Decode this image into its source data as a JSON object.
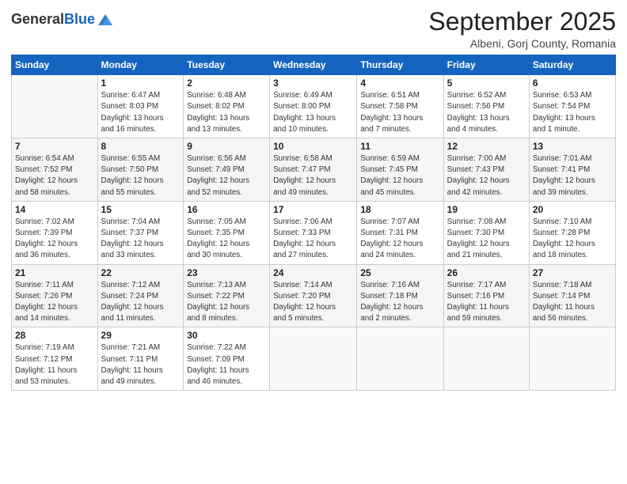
{
  "logo": {
    "general": "General",
    "blue": "Blue"
  },
  "header": {
    "title": "September 2025",
    "subtitle": "Albeni, Gorj County, Romania"
  },
  "days_of_week": [
    "Sunday",
    "Monday",
    "Tuesday",
    "Wednesday",
    "Thursday",
    "Friday",
    "Saturday"
  ],
  "weeks": [
    [
      {
        "num": "",
        "info": ""
      },
      {
        "num": "1",
        "info": "Sunrise: 6:47 AM\nSunset: 8:03 PM\nDaylight: 13 hours\nand 16 minutes."
      },
      {
        "num": "2",
        "info": "Sunrise: 6:48 AM\nSunset: 8:02 PM\nDaylight: 13 hours\nand 13 minutes."
      },
      {
        "num": "3",
        "info": "Sunrise: 6:49 AM\nSunset: 8:00 PM\nDaylight: 13 hours\nand 10 minutes."
      },
      {
        "num": "4",
        "info": "Sunrise: 6:51 AM\nSunset: 7:58 PM\nDaylight: 13 hours\nand 7 minutes."
      },
      {
        "num": "5",
        "info": "Sunrise: 6:52 AM\nSunset: 7:56 PM\nDaylight: 13 hours\nand 4 minutes."
      },
      {
        "num": "6",
        "info": "Sunrise: 6:53 AM\nSunset: 7:54 PM\nDaylight: 13 hours\nand 1 minute."
      }
    ],
    [
      {
        "num": "7",
        "info": "Sunrise: 6:54 AM\nSunset: 7:52 PM\nDaylight: 12 hours\nand 58 minutes."
      },
      {
        "num": "8",
        "info": "Sunrise: 6:55 AM\nSunset: 7:50 PM\nDaylight: 12 hours\nand 55 minutes."
      },
      {
        "num": "9",
        "info": "Sunrise: 6:56 AM\nSunset: 7:49 PM\nDaylight: 12 hours\nand 52 minutes."
      },
      {
        "num": "10",
        "info": "Sunrise: 6:58 AM\nSunset: 7:47 PM\nDaylight: 12 hours\nand 49 minutes."
      },
      {
        "num": "11",
        "info": "Sunrise: 6:59 AM\nSunset: 7:45 PM\nDaylight: 12 hours\nand 45 minutes."
      },
      {
        "num": "12",
        "info": "Sunrise: 7:00 AM\nSunset: 7:43 PM\nDaylight: 12 hours\nand 42 minutes."
      },
      {
        "num": "13",
        "info": "Sunrise: 7:01 AM\nSunset: 7:41 PM\nDaylight: 12 hours\nand 39 minutes."
      }
    ],
    [
      {
        "num": "14",
        "info": "Sunrise: 7:02 AM\nSunset: 7:39 PM\nDaylight: 12 hours\nand 36 minutes."
      },
      {
        "num": "15",
        "info": "Sunrise: 7:04 AM\nSunset: 7:37 PM\nDaylight: 12 hours\nand 33 minutes."
      },
      {
        "num": "16",
        "info": "Sunrise: 7:05 AM\nSunset: 7:35 PM\nDaylight: 12 hours\nand 30 minutes."
      },
      {
        "num": "17",
        "info": "Sunrise: 7:06 AM\nSunset: 7:33 PM\nDaylight: 12 hours\nand 27 minutes."
      },
      {
        "num": "18",
        "info": "Sunrise: 7:07 AM\nSunset: 7:31 PM\nDaylight: 12 hours\nand 24 minutes."
      },
      {
        "num": "19",
        "info": "Sunrise: 7:08 AM\nSunset: 7:30 PM\nDaylight: 12 hours\nand 21 minutes."
      },
      {
        "num": "20",
        "info": "Sunrise: 7:10 AM\nSunset: 7:28 PM\nDaylight: 12 hours\nand 18 minutes."
      }
    ],
    [
      {
        "num": "21",
        "info": "Sunrise: 7:11 AM\nSunset: 7:26 PM\nDaylight: 12 hours\nand 14 minutes."
      },
      {
        "num": "22",
        "info": "Sunrise: 7:12 AM\nSunset: 7:24 PM\nDaylight: 12 hours\nand 11 minutes."
      },
      {
        "num": "23",
        "info": "Sunrise: 7:13 AM\nSunset: 7:22 PM\nDaylight: 12 hours\nand 8 minutes."
      },
      {
        "num": "24",
        "info": "Sunrise: 7:14 AM\nSunset: 7:20 PM\nDaylight: 12 hours\nand 5 minutes."
      },
      {
        "num": "25",
        "info": "Sunrise: 7:16 AM\nSunset: 7:18 PM\nDaylight: 12 hours\nand 2 minutes."
      },
      {
        "num": "26",
        "info": "Sunrise: 7:17 AM\nSunset: 7:16 PM\nDaylight: 11 hours\nand 59 minutes."
      },
      {
        "num": "27",
        "info": "Sunrise: 7:18 AM\nSunset: 7:14 PM\nDaylight: 11 hours\nand 56 minutes."
      }
    ],
    [
      {
        "num": "28",
        "info": "Sunrise: 7:19 AM\nSunset: 7:12 PM\nDaylight: 11 hours\nand 53 minutes."
      },
      {
        "num": "29",
        "info": "Sunrise: 7:21 AM\nSunset: 7:11 PM\nDaylight: 11 hours\nand 49 minutes."
      },
      {
        "num": "30",
        "info": "Sunrise: 7:22 AM\nSunset: 7:09 PM\nDaylight: 11 hours\nand 46 minutes."
      },
      {
        "num": "",
        "info": ""
      },
      {
        "num": "",
        "info": ""
      },
      {
        "num": "",
        "info": ""
      },
      {
        "num": "",
        "info": ""
      }
    ]
  ]
}
